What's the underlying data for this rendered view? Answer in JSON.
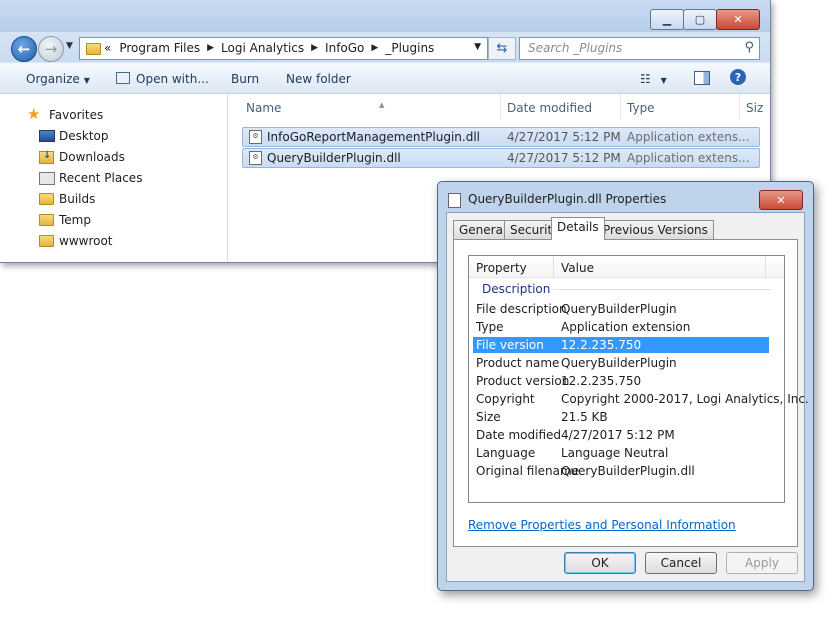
{
  "explorer": {
    "address_crumbs": [
      "Program Files",
      "Logi Analytics",
      "InfoGo",
      "_Plugins"
    ],
    "address_overflow": "«",
    "search_placeholder": "Search _Plugins",
    "toolbar": {
      "organize": "Organize",
      "open_with": "Open with...",
      "burn": "Burn",
      "new_folder": "New folder"
    },
    "nav": {
      "favorites": "Favorites",
      "items": [
        "Desktop",
        "Downloads",
        "Recent Places",
        "Builds",
        "Temp",
        "wwwroot"
      ]
    },
    "columns": {
      "name": "Name",
      "date": "Date modified",
      "type": "Type",
      "size": "Siz"
    },
    "files": [
      {
        "name": "InfoGoReportManagementPlugin.dll",
        "date": "4/27/2017 5:12 PM",
        "type": "Application extens..."
      },
      {
        "name": "QueryBuilderPlugin.dll",
        "date": "4/27/2017 5:12 PM",
        "type": "Application extens..."
      }
    ]
  },
  "dialog": {
    "title": "QueryBuilderPlugin.dll Properties",
    "tabs": [
      "General",
      "Security",
      "Details",
      "Previous Versions"
    ],
    "active_tab": "Details",
    "list_headers": {
      "property": "Property",
      "value": "Value"
    },
    "group": "Description",
    "rows": [
      {
        "property": "File description",
        "value": "QueryBuilderPlugin"
      },
      {
        "property": "Type",
        "value": "Application extension"
      },
      {
        "property": "File version",
        "value": "12.2.235.750"
      },
      {
        "property": "Product name",
        "value": "QueryBuilderPlugin"
      },
      {
        "property": "Product version",
        "value": "12.2.235.750"
      },
      {
        "property": "Copyright",
        "value": "Copyright 2000-2017, Logi Analytics, Inc."
      },
      {
        "property": "Size",
        "value": "21.5 KB"
      },
      {
        "property": "Date modified",
        "value": "4/27/2017 5:12 PM"
      },
      {
        "property": "Language",
        "value": "Language Neutral"
      },
      {
        "property": "Original filename",
        "value": "QueryBuilderPlugin.dll"
      }
    ],
    "selected_row": "File version",
    "link": "Remove Properties and Personal Information",
    "buttons": {
      "ok": "OK",
      "cancel": "Cancel",
      "apply": "Apply"
    }
  },
  "colors": {
    "selection": "#3399ff",
    "link": "#0066cc",
    "close_button": "#c64a34"
  }
}
